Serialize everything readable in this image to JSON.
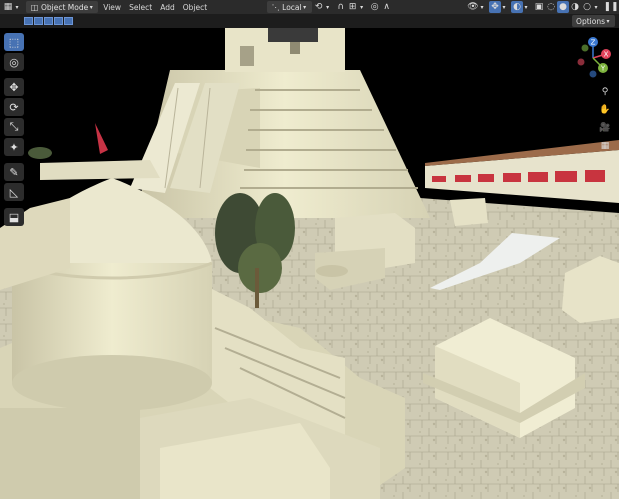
{
  "header": {
    "mode_label": "Object Mode",
    "menus": [
      "View",
      "Select",
      "Add",
      "Object"
    ],
    "transform_space": "Local",
    "icons": {
      "editor_type": "cube-icon",
      "pivot": "pivot-icon",
      "snap": "magnet-icon",
      "proportional": "proportional-edit-icon",
      "visibility": "eye-icon",
      "gizmo": "gizmo-icon",
      "overlay": "overlay-icon",
      "xray": "xray-icon",
      "shading": [
        "wireframe-icon",
        "solid-icon",
        "material-icon",
        "rendered-icon"
      ]
    }
  },
  "subheader": {
    "options_label": "Options"
  },
  "toolbar": {
    "tools": [
      "select-box-icon",
      "cursor-icon",
      "move-icon",
      "rotate-icon",
      "scale-icon",
      "transform-icon",
      "annotate-icon",
      "measure-icon",
      "add-cube-icon"
    ]
  },
  "gizmo": {
    "x": "X",
    "y": "Y",
    "z": "Z",
    "colors": {
      "x": "#e0435b",
      "y": "#7db33e",
      "z": "#3a78d1"
    }
  }
}
